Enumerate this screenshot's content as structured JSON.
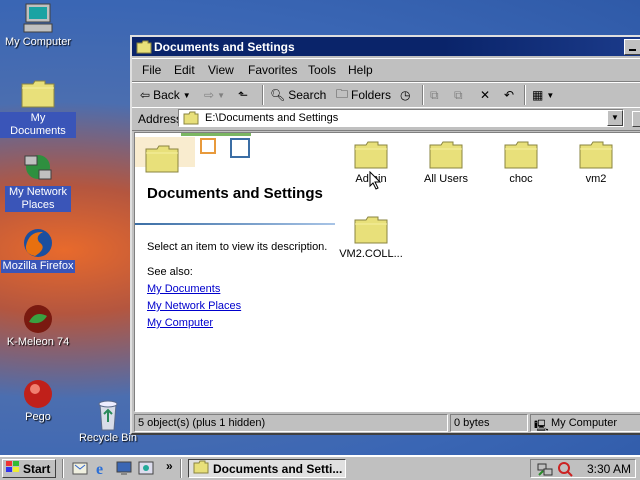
{
  "desktop": {
    "icons": [
      {
        "label": "My Computer"
      },
      {
        "label": "My Documents"
      },
      {
        "label": "My Network Places"
      },
      {
        "label": "Mozilla Firefox"
      },
      {
        "label": "K-Meleon 74"
      },
      {
        "label": "Pego"
      },
      {
        "label": "Recycle Bin"
      }
    ]
  },
  "window": {
    "title": "Documents and Settings",
    "menu": [
      "File",
      "Edit",
      "View",
      "Favorites",
      "Tools",
      "Help"
    ],
    "toolbar": {
      "back": "Back",
      "search": "Search",
      "folders": "Folders"
    },
    "address": {
      "label": "Address",
      "value": "E:\\Documents and Settings"
    },
    "panel": {
      "title": "Documents and Settings",
      "description": "Select an item to view its description.",
      "see_also": "See also:",
      "links": [
        "My Documents",
        "My Network Places",
        "My Computer"
      ]
    },
    "folders": [
      "Admin",
      "All Users",
      "choc",
      "vm2",
      "VM2.COLL..."
    ],
    "status": {
      "objects": "5 object(s) (plus 1 hidden)",
      "size": "0 bytes",
      "zone": "My Computer"
    }
  },
  "taskbar": {
    "start": "Start",
    "task": "Documents and Setti...",
    "chevron": "»",
    "clock": "3:30 AM"
  },
  "colors": {
    "titlebar": "#0a246a",
    "desktop": "#3a66b4",
    "link": "#0000cc",
    "folder": "#e8e07a"
  }
}
